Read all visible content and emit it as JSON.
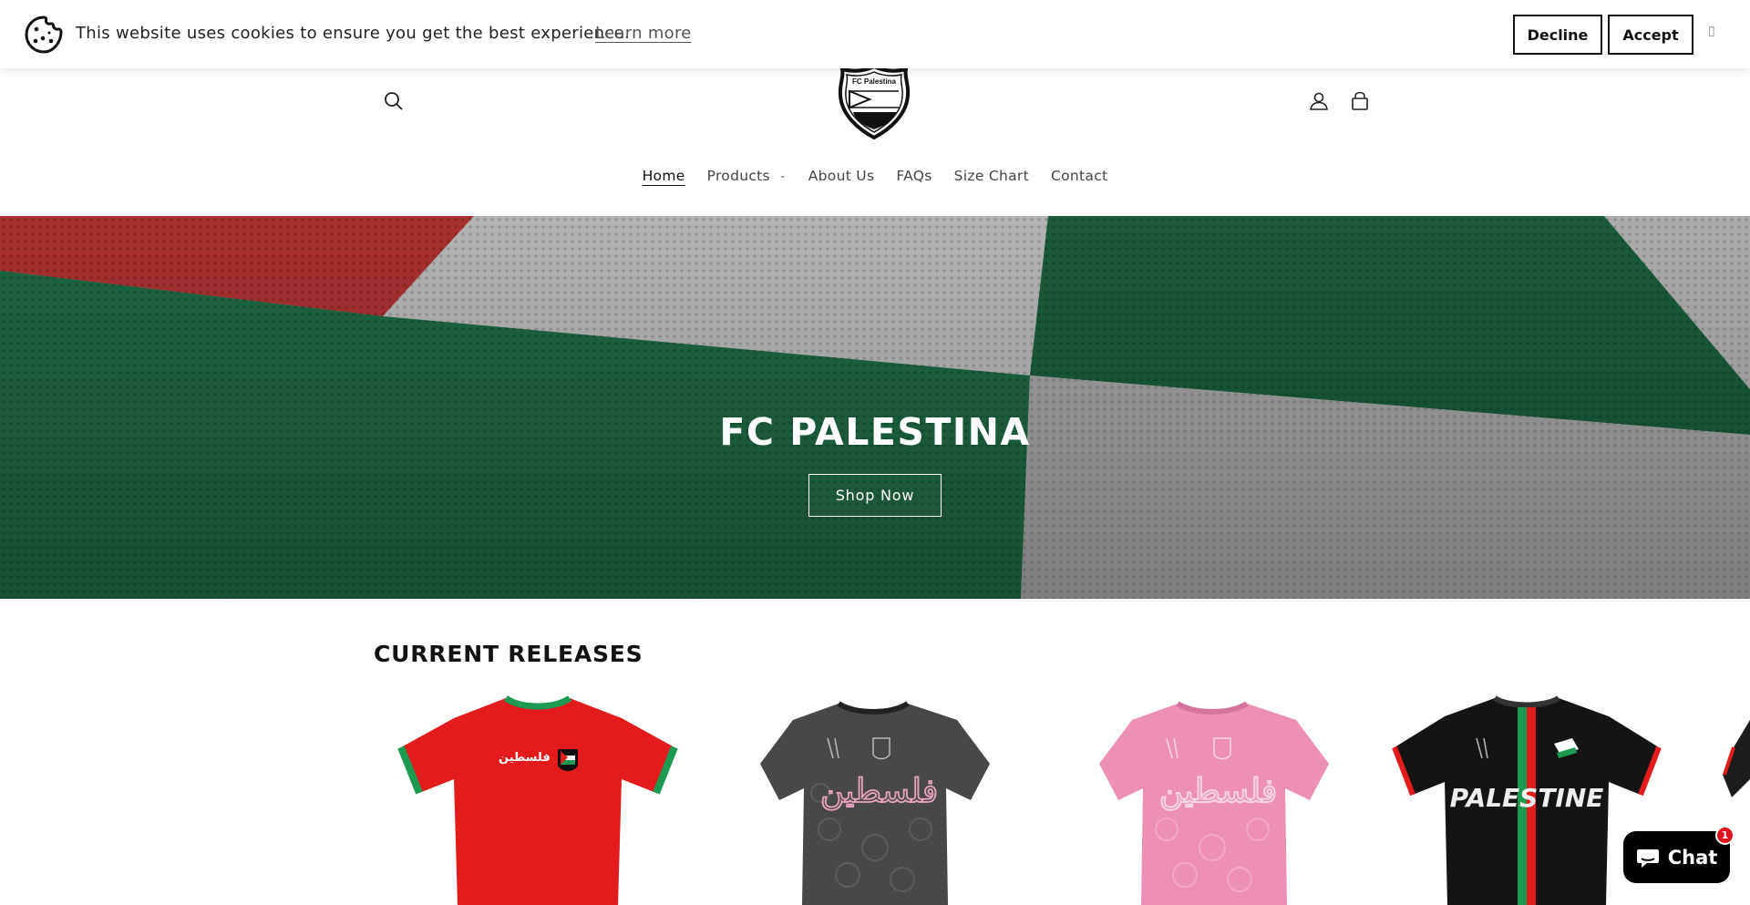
{
  "cookie_banner": {
    "message": "This website uses cookies to ensure you get the best experience.",
    "learn_more": "Learn more",
    "decline": "Decline",
    "accept": "Accept",
    "icon": "cookie-icon",
    "close_icon": "close-icon"
  },
  "header": {
    "logo_text": "FC Palestina",
    "icons": [
      "search-icon",
      "account-icon",
      "cart-icon"
    ]
  },
  "nav": {
    "items": [
      {
        "label": "Home",
        "active": true
      },
      {
        "label": "Products",
        "has_dropdown": true
      },
      {
        "label": "About Us"
      },
      {
        "label": "FAQs"
      },
      {
        "label": "Size Chart"
      },
      {
        "label": "Contact"
      }
    ]
  },
  "hero": {
    "title": "FC PALESTINA",
    "button": "Shop Now"
  },
  "releases": {
    "title": "CURRENT RELEASES",
    "products": [
      {
        "color": "red jersey",
        "text": "فلسطين"
      },
      {
        "color": "grey jersey",
        "text": "فلسطين"
      },
      {
        "color": "pink jersey",
        "text": "فلسطين"
      },
      {
        "color": "black jersey",
        "text": "PALESTINE"
      }
    ]
  },
  "chat": {
    "label": "Chat",
    "badge": "1"
  },
  "colors": {
    "green": "#1e6b45",
    "red": "#c63a3a",
    "white_fabric": "#c9c9c9"
  }
}
